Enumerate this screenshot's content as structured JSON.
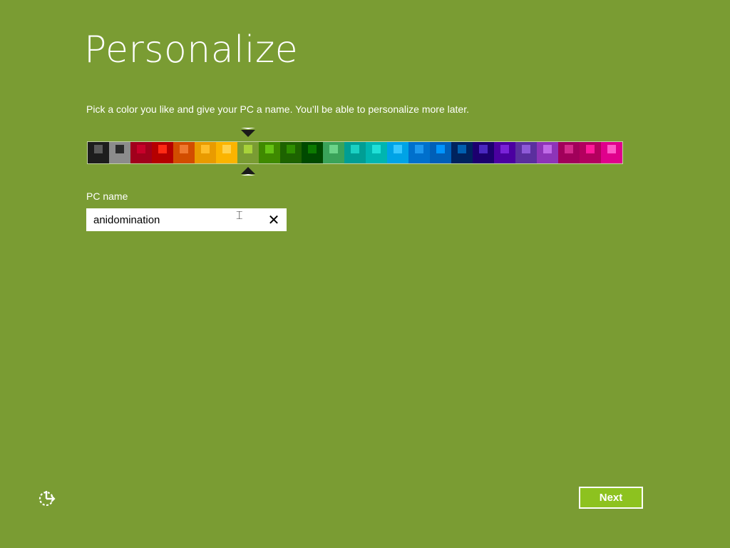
{
  "page": {
    "title": "Personalize",
    "subtitle": "Pick a color you like and give your PC a name. You’ll be able to personalize more later."
  },
  "palette": {
    "selected_index": 7,
    "swatches": [
      {
        "bg": "#1d1d1d",
        "fg": "#5a5a5a"
      },
      {
        "bg": "#8c8c8c",
        "fg": "#2a2a2a"
      },
      {
        "bg": "#a1001c",
        "fg": "#c8002a"
      },
      {
        "bg": "#b50000",
        "fg": "#ff2a14"
      },
      {
        "bg": "#d24d00",
        "fg": "#f07a30"
      },
      {
        "bg": "#e99b00",
        "fg": "#ffbe2a"
      },
      {
        "bg": "#fbb400",
        "fg": "#ffd24a"
      },
      {
        "bg": "#7a9c33",
        "fg": "#a8d23a"
      },
      {
        "bg": "#3f8a00",
        "fg": "#66c314"
      },
      {
        "bg": "#1d6300",
        "fg": "#2f8f00"
      },
      {
        "bg": "#004a00",
        "fg": "#0c7a00"
      },
      {
        "bg": "#3aa35a",
        "fg": "#6cd48a"
      },
      {
        "bg": "#009e94",
        "fg": "#1cd1c4"
      },
      {
        "bg": "#00b5b0",
        "fg": "#20e0d8"
      },
      {
        "bg": "#00a3e6",
        "fg": "#38c8ff"
      },
      {
        "bg": "#0070cc",
        "fg": "#1e98ee"
      },
      {
        "bg": "#005fb8",
        "fg": "#0095ff"
      },
      {
        "bg": "#00235e",
        "fg": "#0060b0"
      },
      {
        "bg": "#1c006e",
        "fg": "#4a28c0"
      },
      {
        "bg": "#4b00a0",
        "fg": "#7a22d8"
      },
      {
        "bg": "#5a2f9e",
        "fg": "#8e5ad8"
      },
      {
        "bg": "#8d34b8",
        "fg": "#c06ae8"
      },
      {
        "bg": "#a1005a",
        "fg": "#d42a8a"
      },
      {
        "bg": "#b3005e",
        "fg": "#ff1a9a"
      },
      {
        "bg": "#e0008c",
        "fg": "#ff5ac8"
      }
    ]
  },
  "pc_name": {
    "label": "PC name",
    "value": "anidomination",
    "clear_glyph": "✕"
  },
  "footer": {
    "ease_of_access_icon": "ease-of-access-icon",
    "next_label": "Next"
  },
  "colors": {
    "background": "#7a9c33",
    "next_button": "#8dc21f"
  }
}
